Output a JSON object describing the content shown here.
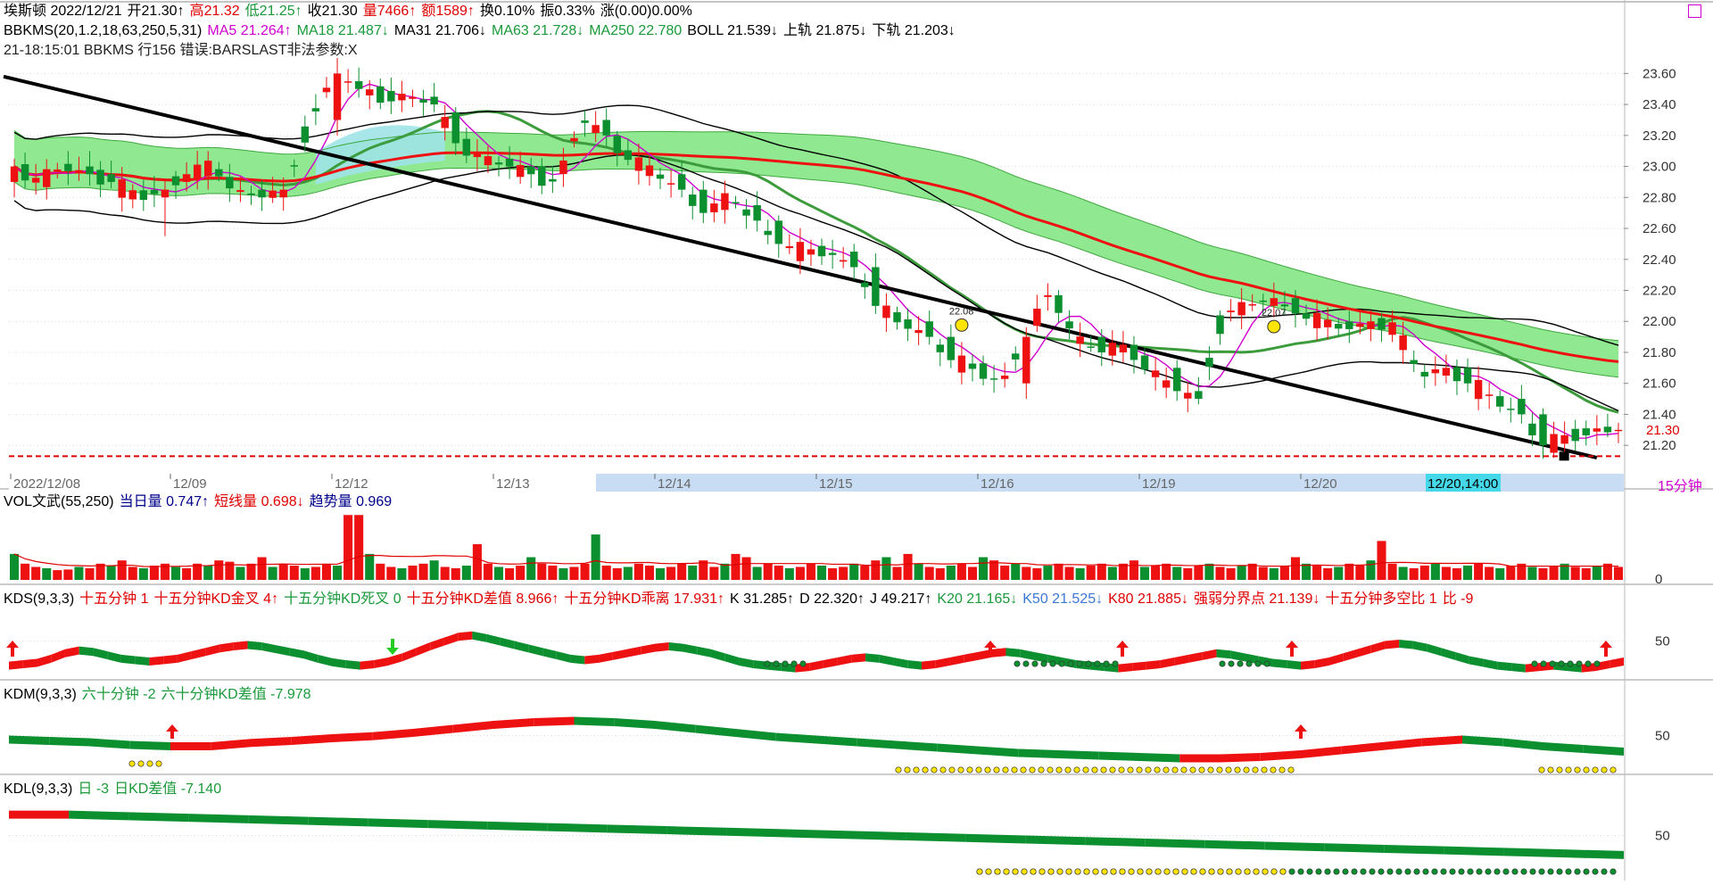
{
  "colors": {
    "up": "#ee1111",
    "down": "#0b8f2f",
    "band_fill": "#90e890",
    "band_edge": "#3fa83f",
    "cyan_fill": "#9fe3e8",
    "ma5": "#d000d0",
    "ma18": "#3c9c3c",
    "ma63": "#ee1111",
    "boll": "#000000",
    "trend": "#000000",
    "grid": "#d8d8d8",
    "axis_bar": "#c8ddf4",
    "highlight": "#44d8e8"
  },
  "main_header": {
    "line1": [
      {
        "text": "埃斯顿 2022/12/21",
        "color": "black"
      },
      {
        "text": "开21.30↑",
        "color": "black"
      },
      {
        "text": "高21.32",
        "color": "red"
      },
      {
        "text": "低21.25↑",
        "color": "green"
      },
      {
        "text": "收21.30",
        "color": "black"
      },
      {
        "text": "量7466↑",
        "color": "red"
      },
      {
        "text": "额1589↑",
        "color": "red"
      },
      {
        "text": "换0.10%",
        "color": "black"
      },
      {
        "text": "振0.33%",
        "color": "black"
      },
      {
        "text": "涨(0.00)0.00%",
        "color": "black"
      }
    ],
    "line2": [
      {
        "text": "BBKMS(20,1.2,18,63,250,5,31)",
        "color": "black"
      },
      {
        "text": "MA5 21.264↑",
        "color": "mag"
      },
      {
        "text": "MA18 21.487↓",
        "color": "green"
      },
      {
        "text": "MA31 21.706↓",
        "color": "black"
      },
      {
        "text": "MA63 21.728↓",
        "color": "green"
      },
      {
        "text": "MA250 22.780",
        "color": "green"
      },
      {
        "text": "BOLL 21.539↓",
        "color": "black"
      },
      {
        "text": "上轨 21.875↓",
        "color": "black"
      },
      {
        "text": "下轨 21.203↓",
        "color": "black"
      }
    ],
    "line3": "21-18:15:01  BBKMS 行156 错误:BARSLAST非法参数:X"
  },
  "vol_header": [
    {
      "text": "VOL文武(55,250)",
      "color": "black"
    },
    {
      "text": "当日量 0.747↑",
      "color": "blue"
    },
    {
      "text": "短线量 0.698↓",
      "color": "red"
    },
    {
      "text": "趋势量 0.969",
      "color": "blue"
    }
  ],
  "kds_header": [
    {
      "text": "KDS(9,3,3)",
      "color": "black"
    },
    {
      "text": "十五分钟 1",
      "color": "red"
    },
    {
      "text": "十五分钟KD金叉 4↑",
      "color": "red"
    },
    {
      "text": "十五分钟KD死叉 0",
      "color": "green"
    },
    {
      "text": "十五分钟KD差值 8.966↑",
      "color": "red"
    },
    {
      "text": "十五分钟KD乖离 17.931↑",
      "color": "red"
    },
    {
      "text": "K 31.285↑",
      "color": "black"
    },
    {
      "text": "D 22.320↑",
      "color": "black"
    },
    {
      "text": "J 49.217↑",
      "color": "black"
    },
    {
      "text": "K20 21.165↓",
      "color": "green"
    },
    {
      "text": "K50 21.525↓",
      "color": "lblue"
    },
    {
      "text": "K80 21.885↓",
      "color": "red"
    },
    {
      "text": "强弱分界点 21.139↓",
      "color": "red"
    },
    {
      "text": "十五分钟多空比 1",
      "color": "red"
    },
    {
      "text": "比 -9",
      "color": "red"
    }
  ],
  "kdm_header": [
    {
      "text": "KDM(9,3,3)",
      "color": "black"
    },
    {
      "text": "六十分钟 -2",
      "color": "green"
    },
    {
      "text": "六十分钟KD差值 -7.978",
      "color": "green"
    }
  ],
  "kdl_header": [
    {
      "text": "KDL(9,3,3)",
      "color": "black"
    },
    {
      "text": "日 -3",
      "color": "green"
    },
    {
      "text": "日KD差值 -7.140",
      "color": "green"
    }
  ],
  "timeframe": "15分钟",
  "chart_data": [
    {
      "type": "candlestick",
      "title": "埃斯顿 15分钟",
      "x_tick_labels": [
        "2022/12/08",
        "12/09",
        "12/12",
        "12/13",
        "12/14",
        "12/15",
        "12/16",
        "12/19",
        "12/20"
      ],
      "highlighted_label": "12/20,14:00",
      "y_ticks": [
        21.2,
        21.4,
        21.6,
        21.8,
        22.0,
        22.2,
        22.4,
        22.6,
        22.8,
        23.0,
        23.2,
        23.4,
        23.6
      ],
      "ylim": [
        21.08,
        23.7
      ],
      "last_price": "21.30",
      "support_line": 21.13,
      "annotations": [
        {
          "text": "22.08",
          "date": "12/16",
          "value": 22.08
        },
        {
          "text": "22.07",
          "date": "12/20",
          "value": 22.07
        }
      ],
      "ohlc_keypoints": [
        [
          22.9,
          23.05,
          22.8,
          23.0
        ],
        [
          23.0,
          23.1,
          22.75,
          22.9
        ],
        [
          22.9,
          23.05,
          22.85,
          23.0
        ],
        [
          23.0,
          23.1,
          22.9,
          22.95
        ],
        [
          22.95,
          23.0,
          22.85,
          22.9
        ],
        [
          22.85,
          22.95,
          22.75,
          22.8
        ],
        [
          22.8,
          22.9,
          22.55,
          22.85
        ],
        [
          22.9,
          23.0,
          22.85,
          22.95
        ],
        [
          22.95,
          23.05,
          22.9,
          23.0
        ],
        [
          23.0,
          23.05,
          22.8,
          22.85
        ],
        [
          22.85,
          22.9,
          22.75,
          22.8
        ],
        [
          22.8,
          22.95,
          22.75,
          22.85
        ],
        [
          22.85,
          23.3,
          22.4,
          23.3
        ],
        [
          23.3,
          23.7,
          23.2,
          23.6
        ],
        [
          23.55,
          23.6,
          23.3,
          23.5
        ],
        [
          23.45,
          23.55,
          23.35,
          23.45
        ],
        [
          23.45,
          23.5,
          23.35,
          23.45
        ],
        [
          23.45,
          23.5,
          23.35,
          23.4
        ],
        [
          23.35,
          23.4,
          23.1,
          23.15
        ],
        [
          23.15,
          23.2,
          22.95,
          23.05
        ],
        [
          23.05,
          23.1,
          22.95,
          23.0
        ],
        [
          23.0,
          23.05,
          22.9,
          22.95
        ],
        [
          22.95,
          23.0,
          22.85,
          22.9
        ],
        [
          22.9,
          23.6,
          22.8,
          23.3
        ],
        [
          23.3,
          23.35,
          23.15,
          23.2
        ],
        [
          23.2,
          23.25,
          23.0,
          23.05
        ],
        [
          23.05,
          23.1,
          22.9,
          22.95
        ],
        [
          22.95,
          23.0,
          22.8,
          22.85
        ],
        [
          22.85,
          22.9,
          22.3,
          22.7
        ],
        [
          22.7,
          22.9,
          22.6,
          22.8
        ],
        [
          22.75,
          22.8,
          22.6,
          22.65
        ],
        [
          22.65,
          22.7,
          22.45,
          22.5
        ],
        [
          22.5,
          22.55,
          22.4,
          22.45
        ],
        [
          22.45,
          22.5,
          22.35,
          22.45
        ],
        [
          22.45,
          22.5,
          22.3,
          22.35
        ],
        [
          22.35,
          22.4,
          22.05,
          22.1
        ],
        [
          22.1,
          22.15,
          21.95,
          22.0
        ],
        [
          22.0,
          22.05,
          21.85,
          21.9
        ],
        [
          21.9,
          21.95,
          21.7,
          21.75
        ],
        [
          21.75,
          21.8,
          21.65,
          21.7
        ],
        [
          21.7,
          21.75,
          21.55,
          21.6
        ],
        [
          21.6,
          21.95,
          21.5,
          21.9
        ],
        [
          21.9,
          22.4,
          21.8,
          22.2
        ],
        [
          22.2,
          22.25,
          21.8,
          21.9
        ],
        [
          21.9,
          21.95,
          21.75,
          21.8
        ],
        [
          21.8,
          21.9,
          21.7,
          21.85
        ],
        [
          21.85,
          21.9,
          21.6,
          21.7
        ],
        [
          21.7,
          21.75,
          21.5,
          21.55
        ],
        [
          21.55,
          21.6,
          21.45,
          21.5
        ],
        [
          21.5,
          22.3,
          21.45,
          22.05
        ],
        [
          22.05,
          22.15,
          21.95,
          22.1
        ],
        [
          22.1,
          22.25,
          22.05,
          22.15
        ],
        [
          22.15,
          22.2,
          22.0,
          22.05
        ],
        [
          22.05,
          22.1,
          21.95,
          22.0
        ],
        [
          22.0,
          22.05,
          21.9,
          21.95
        ],
        [
          21.95,
          22.05,
          21.9,
          22.0
        ],
        [
          22.0,
          22.05,
          21.9,
          21.95
        ],
        [
          21.95,
          22.0,
          21.55,
          21.65
        ],
        [
          21.65,
          21.75,
          21.6,
          21.7
        ],
        [
          21.7,
          21.75,
          21.55,
          21.6
        ],
        [
          21.6,
          21.65,
          21.45,
          21.5
        ],
        [
          21.5,
          21.55,
          21.35,
          21.4
        ],
        [
          21.4,
          21.45,
          21.15,
          21.2
        ],
        [
          21.2,
          21.3,
          21.15,
          21.25
        ],
        [
          21.25,
          21.4,
          21.2,
          21.3
        ],
        [
          21.3,
          21.32,
          21.25,
          21.3
        ]
      ]
    },
    {
      "type": "bar",
      "title": "VOL文武(55,250)",
      "y_ticks": [
        0
      ],
      "values": [
        40,
        25,
        20,
        18,
        15,
        16,
        20,
        18,
        25,
        22,
        30,
        20,
        18,
        22,
        25,
        20,
        18,
        25,
        22,
        30,
        28,
        20,
        25,
        35,
        20,
        25,
        22,
        18,
        20,
        25,
        22,
        100,
        100,
        40,
        25,
        20,
        18,
        22,
        25,
        30,
        20,
        18,
        22,
        55,
        25,
        20,
        18,
        22,
        35,
        25,
        22,
        18,
        20,
        25,
        70,
        22,
        18,
        20,
        25,
        22,
        18,
        20,
        25,
        22,
        30,
        20,
        25,
        40,
        35,
        20,
        25,
        22,
        18,
        20,
        25,
        22,
        18,
        20,
        25,
        22,
        30,
        35,
        20,
        40,
        25,
        20,
        18,
        22,
        25,
        20,
        35,
        30,
        22,
        25,
        20,
        18,
        22,
        25,
        20,
        18,
        22,
        25,
        20,
        25,
        30,
        20,
        22,
        25,
        20,
        18,
        22,
        25,
        20,
        18,
        22,
        25,
        20,
        18,
        22,
        35,
        25,
        22,
        18,
        20,
        25,
        22,
        30,
        60,
        25,
        20,
        18,
        22,
        25,
        20,
        18,
        22,
        25,
        20,
        18,
        22,
        25,
        20,
        18,
        22,
        25,
        20,
        18,
        22,
        25,
        20
      ]
    },
    {
      "type": "area",
      "title": "KDS(9,3,3)",
      "y_ticks": [
        50
      ],
      "values": [
        20,
        22,
        24,
        30,
        38,
        42,
        40,
        35,
        30,
        28,
        26,
        28,
        30,
        35,
        40,
        45,
        48,
        50,
        48,
        44,
        40,
        36,
        30,
        25,
        22,
        20,
        22,
        26,
        32,
        40,
        48,
        55,
        62,
        64,
        60,
        55,
        50,
        45,
        40,
        35,
        30,
        28,
        30,
        34,
        38,
        42,
        46,
        48,
        46,
        42,
        38,
        32,
        26,
        22,
        20,
        18,
        16,
        18,
        22,
        26,
        30,
        32,
        30,
        26,
        22,
        20,
        22,
        26,
        30,
        34,
        38,
        40,
        38,
        34,
        30,
        26,
        22,
        20,
        18,
        16,
        18,
        20,
        22,
        26,
        30,
        34,
        38,
        36,
        32,
        28,
        24,
        22,
        20,
        22,
        26,
        32,
        38,
        44,
        50,
        52,
        50,
        46,
        40,
        34,
        28,
        24,
        20,
        18,
        16,
        18,
        20,
        18,
        16,
        18,
        22,
        26
      ]
    },
    {
      "type": "area",
      "title": "KDM(9,3,3)",
      "y_ticks": [
        50
      ],
      "values": [
        50,
        48,
        46,
        42,
        40,
        40,
        45,
        48,
        52,
        55,
        60,
        66,
        72,
        76,
        78,
        76,
        72,
        66,
        60,
        54,
        50,
        46,
        42,
        38,
        34,
        30,
        28,
        26,
        24,
        22,
        22,
        24,
        28,
        34,
        40,
        46,
        50,
        46,
        40,
        36,
        32
      ]
    },
    {
      "type": "area",
      "title": "KDL(9,3,3)",
      "y_ticks": [
        50
      ],
      "values": [
        82,
        82,
        80,
        78,
        76,
        74,
        72,
        70,
        68,
        66,
        64,
        62,
        60,
        58,
        56,
        54,
        52,
        50,
        48,
        46,
        44,
        42,
        40,
        38,
        36,
        34,
        32,
        30
      ]
    }
  ]
}
